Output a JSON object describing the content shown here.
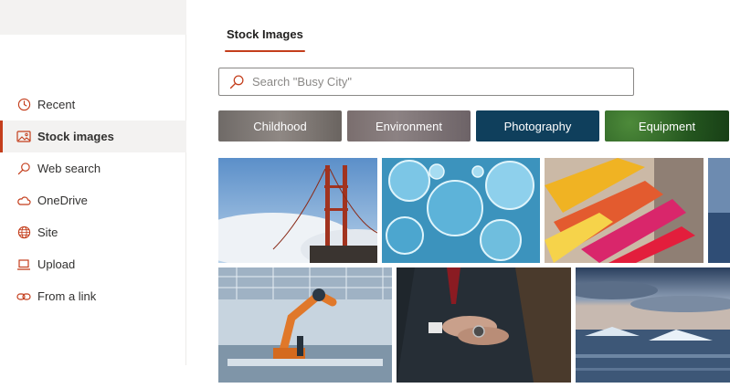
{
  "sidebar": {
    "items": [
      {
        "label": "Recent",
        "icon": "clock-icon",
        "selected": false
      },
      {
        "label": "Stock images",
        "icon": "image-icon",
        "selected": true
      },
      {
        "label": "Web search",
        "icon": "search-icon",
        "selected": false
      },
      {
        "label": "OneDrive",
        "icon": "cloud-icon",
        "selected": false
      },
      {
        "label": "Site",
        "icon": "globe-icon",
        "selected": false
      },
      {
        "label": "Upload",
        "icon": "laptop-icon",
        "selected": false
      },
      {
        "label": "From a link",
        "icon": "link-icon",
        "selected": false
      }
    ]
  },
  "main": {
    "tab_label": "Stock Images",
    "search": {
      "placeholder": "Search \"Busy City\"",
      "value": ""
    },
    "categories": [
      {
        "label": "Childhood"
      },
      {
        "label": "Environment"
      },
      {
        "label": "Photography"
      },
      {
        "label": "Equipment"
      }
    ],
    "images": [
      {
        "subject": "golden-gate-bridge"
      },
      {
        "subject": "soap-bubbles"
      },
      {
        "subject": "colorful-test-tubes"
      },
      {
        "subject": "ocean-edge"
      },
      {
        "subject": "robotic-arm-factory"
      },
      {
        "subject": "businessman-watch"
      },
      {
        "subject": "icy-lake-sunset"
      }
    ]
  },
  "colors": {
    "accent": "#c43e1c",
    "photography_chip": "#0f3f5c",
    "equipment_chip": "#2f6b27"
  }
}
